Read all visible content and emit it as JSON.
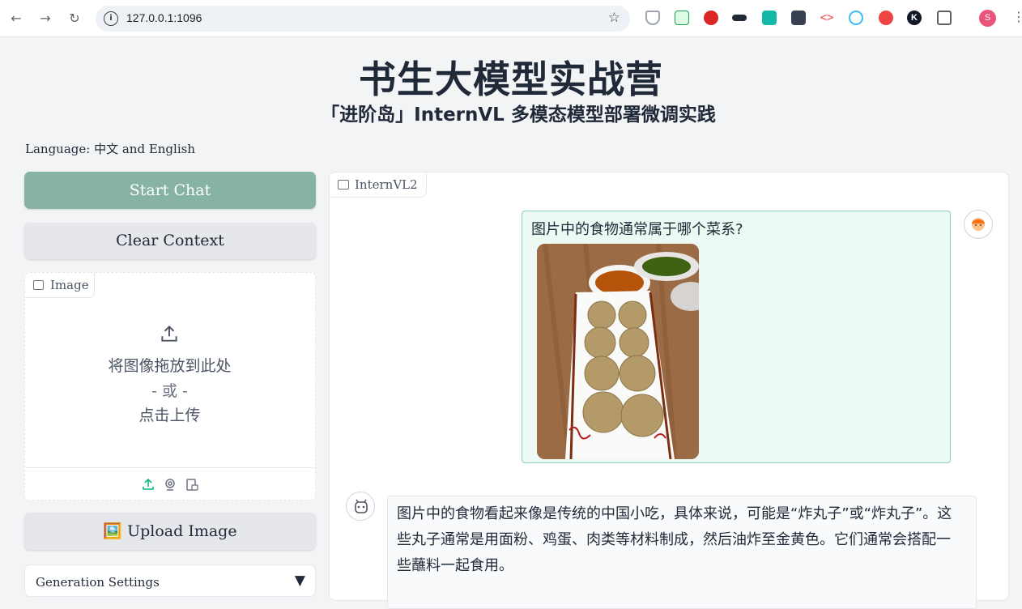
{
  "browser": {
    "url": "127.0.0.1:1096",
    "profile_initial": "S"
  },
  "page": {
    "title": "书生大模型实战营",
    "subtitle": "「进阶岛」InternVL 多模态模型部署微调实践",
    "language_label": "Language: 中文 and English"
  },
  "sidebar": {
    "start_chat_label": "Start Chat",
    "clear_context_label": "Clear Context",
    "image_label": "Image",
    "drop_text": "将图像拖放到此处",
    "or_text": "- 或 -",
    "click_upload_text": "点击上传",
    "upload_image_label": "🖼️ Upload Image",
    "generation_settings_label": "Generation Settings"
  },
  "chat": {
    "tab_label": "InternVL2",
    "user_message": "图片中的食物通常属于哪个菜系?",
    "bot_message": "图片中的食物看起来像是传统的中国小吃，具体来说，可能是“炸丸子”或“炸丸子”。这些丸子通常是用面粉、鸡蛋、肉类等材料制成，然后油炸至金黄色。它们通常会搭配一些蘸料一起食用。"
  },
  "colors": {
    "primary_button": "#86b3a4",
    "user_bubble": "#ecfaf3",
    "user_bubble_border": "#8ad3b0",
    "accent_icon": "#10b981"
  }
}
